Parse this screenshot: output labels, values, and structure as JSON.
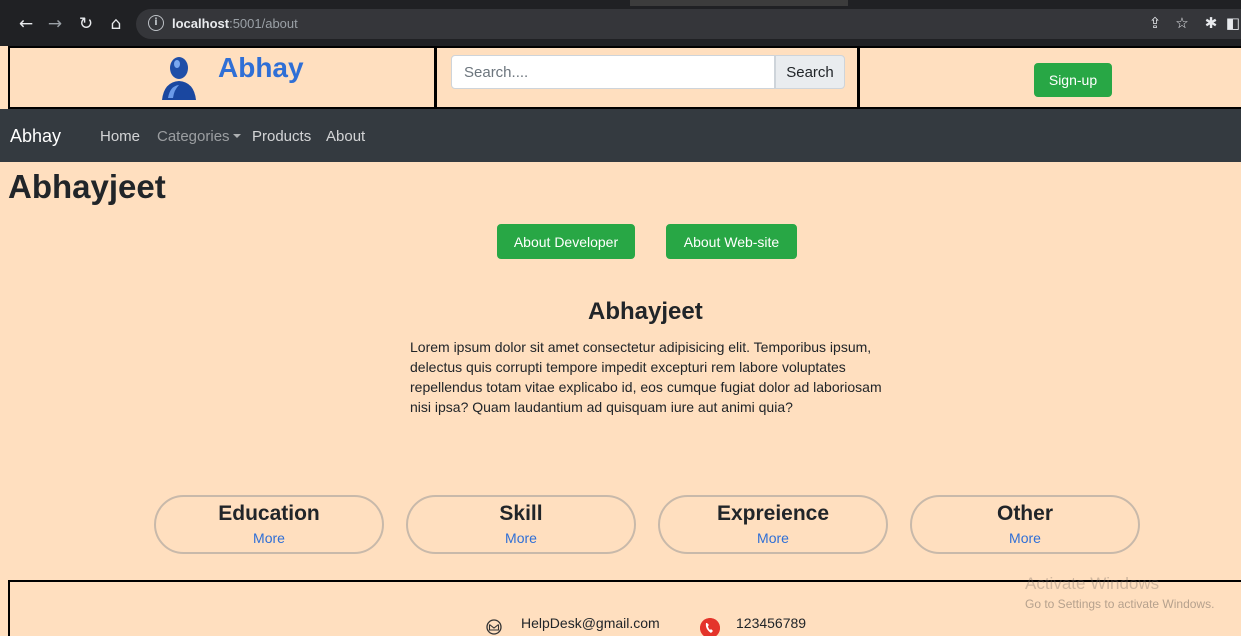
{
  "browser": {
    "url_host": "localhost",
    "url_path": ":5001/about"
  },
  "header": {
    "brand": "Abhay",
    "search_placeholder": "Search....",
    "search_button": "Search",
    "signup_button": "Sign-up"
  },
  "navbar": {
    "brand": "Abhay",
    "links": [
      "Home",
      "Categories",
      "Products",
      "About"
    ]
  },
  "main": {
    "title": "Abhayjeet",
    "buttons": [
      "About Developer",
      "About Web-site"
    ],
    "section_title": "Abhayjeet",
    "paragraph": "Lorem ipsum dolor sit amet consectetur adipisicing elit. Temporibus ipsum, delectus quis corrupti tempore impedit excepturi rem labore voluptates repellendus totam vitae explicabo id, eos cumque fugiat dolor ad laboriosam nisi ipsa? Quam laudantium ad quisquam iure aut animi quia?",
    "cards": [
      {
        "title": "Education",
        "link": "More"
      },
      {
        "title": "Skill",
        "link": "More"
      },
      {
        "title": "Expreience",
        "link": "More"
      },
      {
        "title": "Other",
        "link": "More"
      }
    ]
  },
  "footer": {
    "email": "HelpDesk@gmail.com",
    "phone": "123456789"
  },
  "watermark": {
    "line1": "Activate Windows",
    "line2": "Go to Settings to activate Windows."
  },
  "colors": {
    "page_bg": "#ffdfbf",
    "navbar_bg": "#343a40",
    "brand_blue": "#2f6fd6",
    "button_green": "#28a745"
  }
}
